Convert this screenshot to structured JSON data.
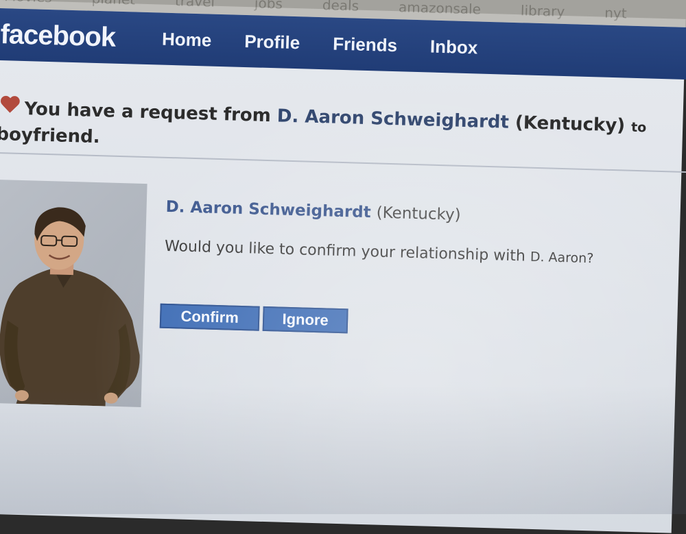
{
  "bookmarks": [
    "Movies",
    "planet",
    "travel",
    "jobs",
    "deals",
    "amazonsale",
    "library",
    "nyt"
  ],
  "navbar": {
    "logo": "facebook",
    "links": [
      "Home",
      "Profile",
      "Friends",
      "Inbox"
    ],
    "brand_color": "#2a4884"
  },
  "request": {
    "prefix": "You have a request from",
    "name": "D. Aaron Schweighardt",
    "location": "(Kentucky)",
    "tail": "to",
    "second_line": "boyfriend."
  },
  "profile": {
    "name": "D. Aaron Schweighardt",
    "location": "(Kentucky)",
    "question": "Would you like to confirm your relationship with",
    "question_tail": "D. Aaron?"
  },
  "actions": {
    "confirm_label": "Confirm",
    "ignore_label": "Ignore",
    "button_color": "#3d6cb5"
  },
  "icons": {
    "heart": "heart-icon"
  }
}
